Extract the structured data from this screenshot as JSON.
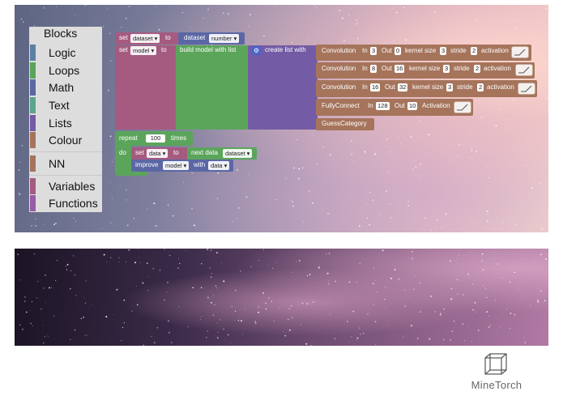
{
  "toolbox": {
    "title": "Blocks",
    "categories": [
      {
        "label": "Logic",
        "color": "#5b80a5"
      },
      {
        "label": "Loops",
        "color": "#5ba55b"
      },
      {
        "label": "Math",
        "color": "#5b67a5"
      },
      {
        "label": "Text",
        "color": "#5ba58c"
      },
      {
        "label": "Lists",
        "color": "#745ba5"
      },
      {
        "label": "Colour",
        "color": "#a5745b"
      },
      {
        "label": "NN",
        "color": "#a5745b"
      },
      {
        "label": "Variables",
        "color": "#a55b80"
      },
      {
        "label": "Functions",
        "color": "#995ba5"
      }
    ]
  },
  "blocks": {
    "set_dataset": {
      "set": "set",
      "var": "dataset ▾",
      "to": "to"
    },
    "dataset_number": {
      "label": "dataset",
      "field": "number ▾"
    },
    "set_model": {
      "set": "set",
      "var": "model ▾",
      "to": "to"
    },
    "build_model": {
      "label": "build model with list"
    },
    "create_list": {
      "label": "create list with"
    },
    "conv1": {
      "name": "Convolution",
      "in_label": "In",
      "in": "3",
      "out_label": "Out",
      "out": "0",
      "ks_label": "kernel size",
      "ks": "3",
      "stride_label": "stride",
      "stride": "2",
      "act_label": "activation"
    },
    "conv2": {
      "name": "Convolution",
      "in_label": "In",
      "in": "8",
      "out_label": "Out",
      "out": "16",
      "ks_label": "kernel size",
      "ks": "3",
      "stride_label": "stride",
      "stride": "2",
      "act_label": "activation"
    },
    "conv3": {
      "name": "Convolution",
      "in_label": "In",
      "in": "16",
      "out_label": "Out",
      "out": "32",
      "ks_label": "kernel size",
      "ks": "3",
      "stride_label": "stride",
      "stride": "2",
      "act_label": "activation"
    },
    "fc": {
      "name": "FullyConnect",
      "in_label": "In",
      "in": "128",
      "out_label": "Out",
      "out": "10",
      "act_label": "Activation"
    },
    "guess": {
      "name": "GuessCategory"
    },
    "repeat": {
      "label": "repeat",
      "count": "100",
      "times": "times",
      "do": "do"
    },
    "set_data": {
      "set": "set",
      "var": "data ▾",
      "to": "to"
    },
    "next_data": {
      "label": "next data",
      "field": "dataset ▾"
    },
    "improve": {
      "label": "improve",
      "model": "model ▾",
      "with": "with",
      "data": "data ▾"
    }
  },
  "colors": {
    "variables": "#a55b80",
    "procedures": "#5ba55b",
    "lists": "#745ba5",
    "nn": "#a5745b"
  },
  "brand": {
    "name": "MineTorch",
    "icon": "cube-icon"
  }
}
